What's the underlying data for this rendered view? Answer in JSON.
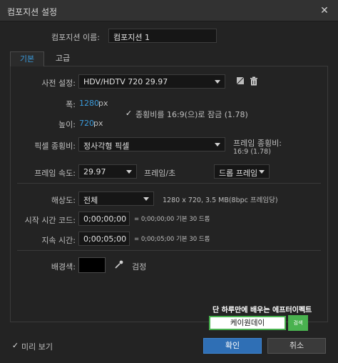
{
  "window": {
    "title": "컴포지션 설정",
    "close": "✕"
  },
  "comp_name": {
    "label": "컴포지션 이름:",
    "value": "컴포지션 1"
  },
  "tabs": [
    {
      "label": "기본"
    },
    {
      "label": "고급"
    }
  ],
  "preset": {
    "label": "사전 설정:",
    "value": "HDV/HDTV 720 29.97"
  },
  "width": {
    "label": "폭:",
    "value": "1280",
    "unit": "px"
  },
  "height": {
    "label": "높이:",
    "value": "720",
    "unit": "px"
  },
  "lock_aspect": {
    "label": "종횡비를 16:9(으)로 잠금 (1.78)",
    "checked": true
  },
  "pixel_aspect": {
    "label": "픽셀 종횡비:",
    "value": "정사각형 픽셀"
  },
  "frame_aspect": {
    "label": "프레임 종횡비:",
    "value": "16:9 (1.78)"
  },
  "frame_rate": {
    "label": "프레임 속도:",
    "value": "29.97",
    "unit": "프레임/초",
    "mode": "드롭 프레임"
  },
  "resolution": {
    "label": "해상도:",
    "value": "전체",
    "info": "1280 x 720, 3.5 MB(8bpc 프레임당)"
  },
  "start_timecode": {
    "label": "시작 시간 코드:",
    "value": "0;00;00;00",
    "info": "= 0;00;00;00 기본 30 드롭"
  },
  "duration": {
    "label": "지속 시간:",
    "value": "0;00;05;00",
    "info": "= 0;00;05;00 기본 30 드롭"
  },
  "background": {
    "label": "배경색:",
    "color_name": "검정",
    "color": "#000000"
  },
  "ad": {
    "title": "단 하루만에 배우는 에프터이펙트",
    "input_value": "케이원데이",
    "button": "검색",
    "accent": "#49b24f"
  },
  "preview": {
    "label": "미리 보기",
    "checked": true
  },
  "buttons": {
    "ok": "확인",
    "cancel": "취소"
  },
  "colors": {
    "accent_blue": "#3a9bdc",
    "primary_button": "#2f6fb5"
  }
}
